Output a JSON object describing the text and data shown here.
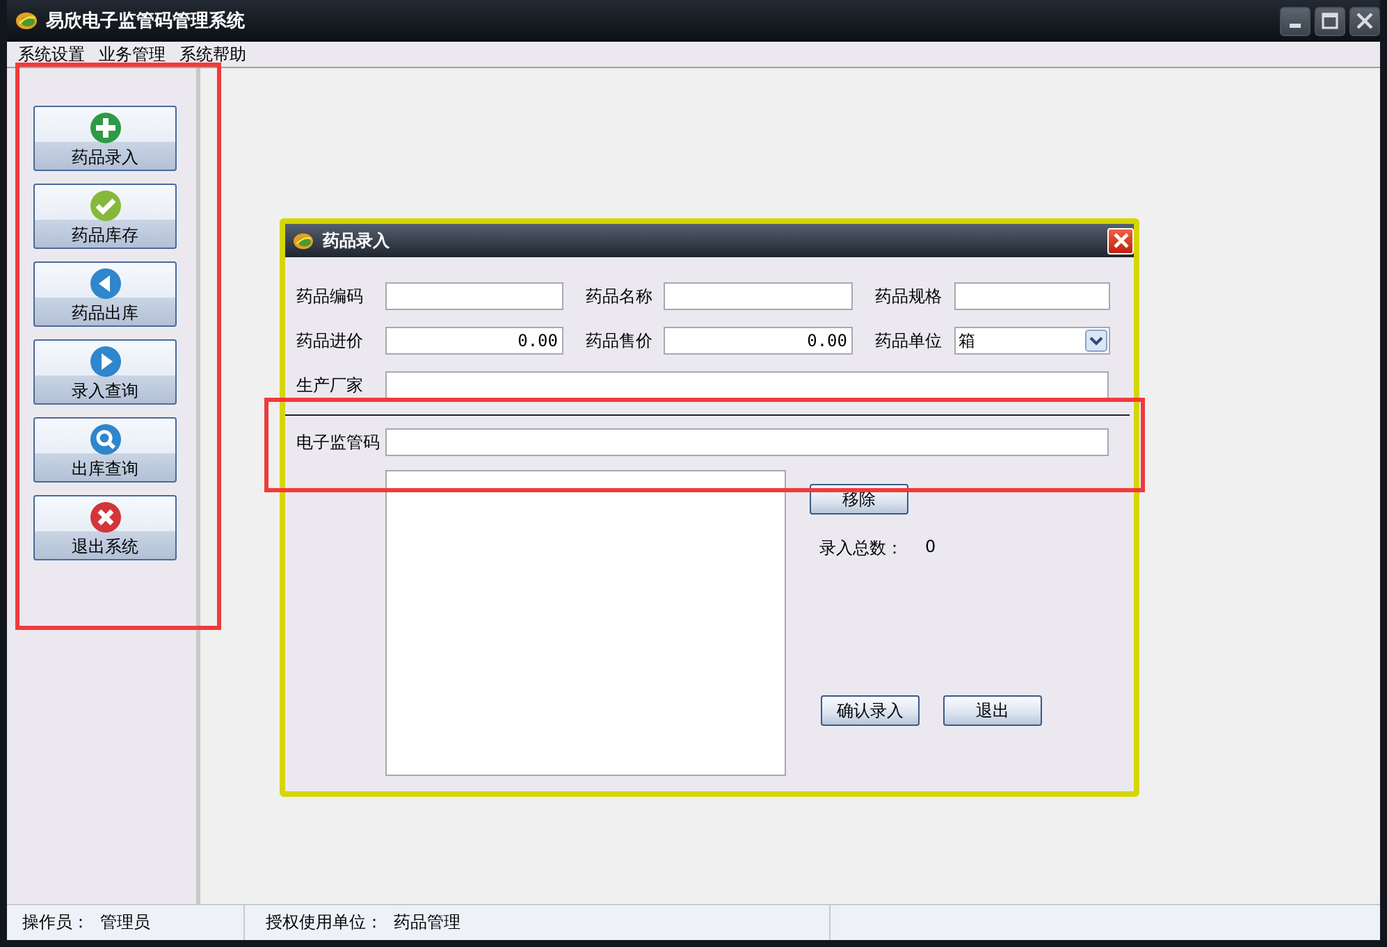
{
  "window": {
    "title": "易欣电子监管码管理系统"
  },
  "menu": [
    "系统设置",
    "业务管理",
    "系统帮助"
  ],
  "sidebar": {
    "buttons": [
      {
        "label": "药品录入",
        "kind": "add"
      },
      {
        "label": "药品库存",
        "kind": "check"
      },
      {
        "label": "药品出库",
        "kind": "back"
      },
      {
        "label": "录入查询",
        "kind": "play"
      },
      {
        "label": "出库查询",
        "kind": "search"
      },
      {
        "label": "退出系统",
        "kind": "close"
      }
    ]
  },
  "dialog": {
    "title": "药品录入",
    "rows": [
      [
        {
          "label": "药品编码",
          "kind": "text"
        },
        {
          "label": "药品名称",
          "kind": "text"
        },
        {
          "label": "药品规格",
          "kind": "text"
        }
      ],
      [
        {
          "label": "药品进价",
          "kind": "number",
          "value": "0.00"
        },
        {
          "label": "药品售价",
          "kind": "number",
          "value": "0.00"
        },
        {
          "label": "药品单位",
          "kind": "select",
          "value": "箱"
        }
      ],
      [
        {
          "label": "生产厂家",
          "kind": "wide"
        }
      ]
    ],
    "barcode_field": {
      "label": "电子监管码"
    },
    "remove_button": "移除",
    "total": {
      "label": "录入总数：",
      "value": "0"
    },
    "buttons": [
      "确认录入",
      "退出"
    ]
  },
  "status_bar": [
    {
      "label": "操作员：",
      "value": "管理员"
    },
    {
      "label": "授权使用单位：",
      "value": "药品管理"
    }
  ]
}
